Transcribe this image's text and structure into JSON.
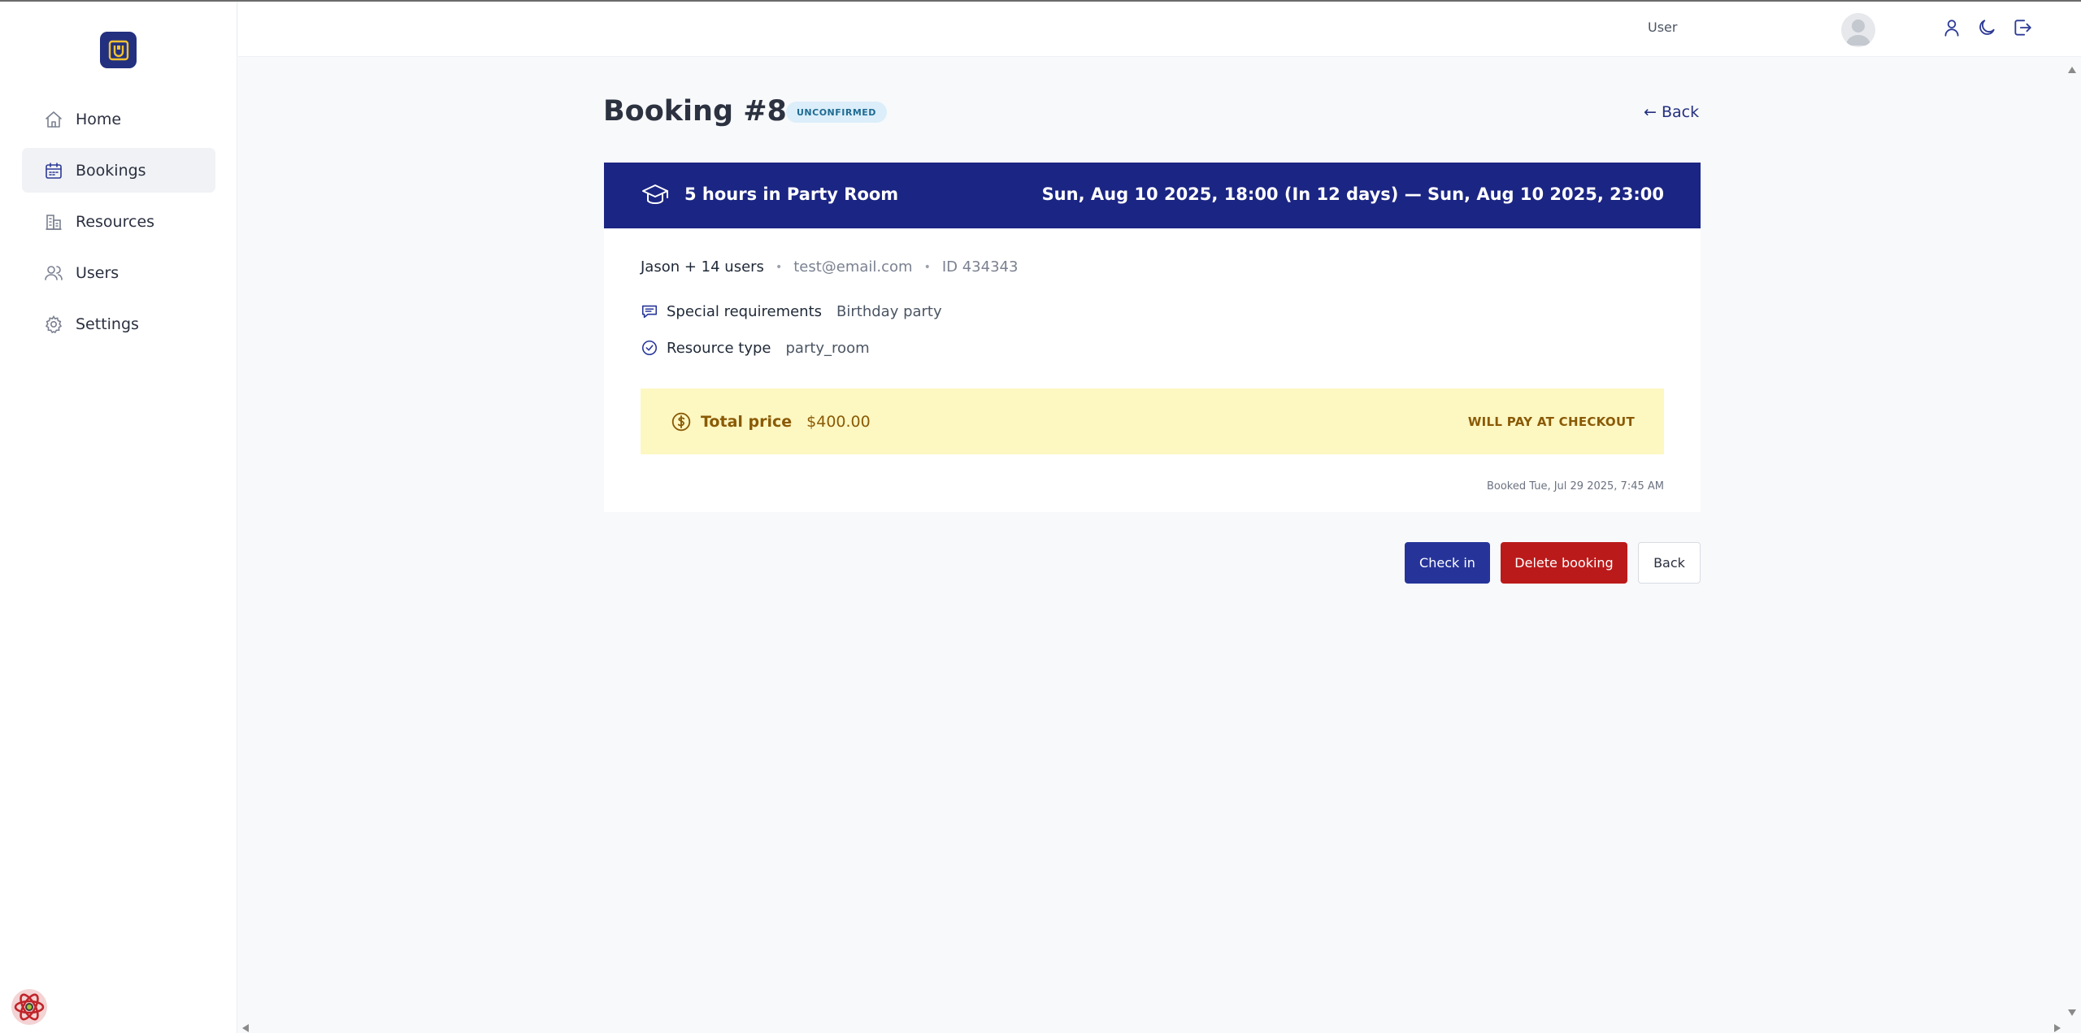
{
  "sidebar": {
    "items": [
      {
        "label": "Home",
        "icon": "home-icon"
      },
      {
        "label": "Bookings",
        "icon": "calendar-icon",
        "active": true
      },
      {
        "label": "Resources",
        "icon": "building-icon"
      },
      {
        "label": "Users",
        "icon": "users-icon"
      },
      {
        "label": "Settings",
        "icon": "gear-icon"
      }
    ]
  },
  "header": {
    "user_label": "User"
  },
  "page": {
    "title": "Booking #8",
    "status": "UNCONFIRMED",
    "back_link": "← Back"
  },
  "booking": {
    "title": "5 hours in Party Room",
    "dates": "Sun, Aug 10 2025, 18:00 (In 12 days) — Sun, Aug 10 2025, 23:00",
    "guests": "Jason + 14 users",
    "email": "test@email.com",
    "id_text": "ID 434343",
    "special_label": "Special requirements",
    "special_value": "Birthday party",
    "resource_label": "Resource type",
    "resource_value": "party_room",
    "price_label": "Total price",
    "price_value": "$400.00",
    "pay_status": "WILL PAY AT CHECKOUT",
    "booked_at": "Booked Tue, Jul 29 2025, 7:45 AM"
  },
  "actions": {
    "check_in": "Check in",
    "delete": "Delete booking",
    "back": "Back"
  },
  "colors": {
    "primary": "#1b2583",
    "danger": "#bb1a1a",
    "warning_bg": "#fdf7c2",
    "badge_bg": "#dbeefa"
  }
}
